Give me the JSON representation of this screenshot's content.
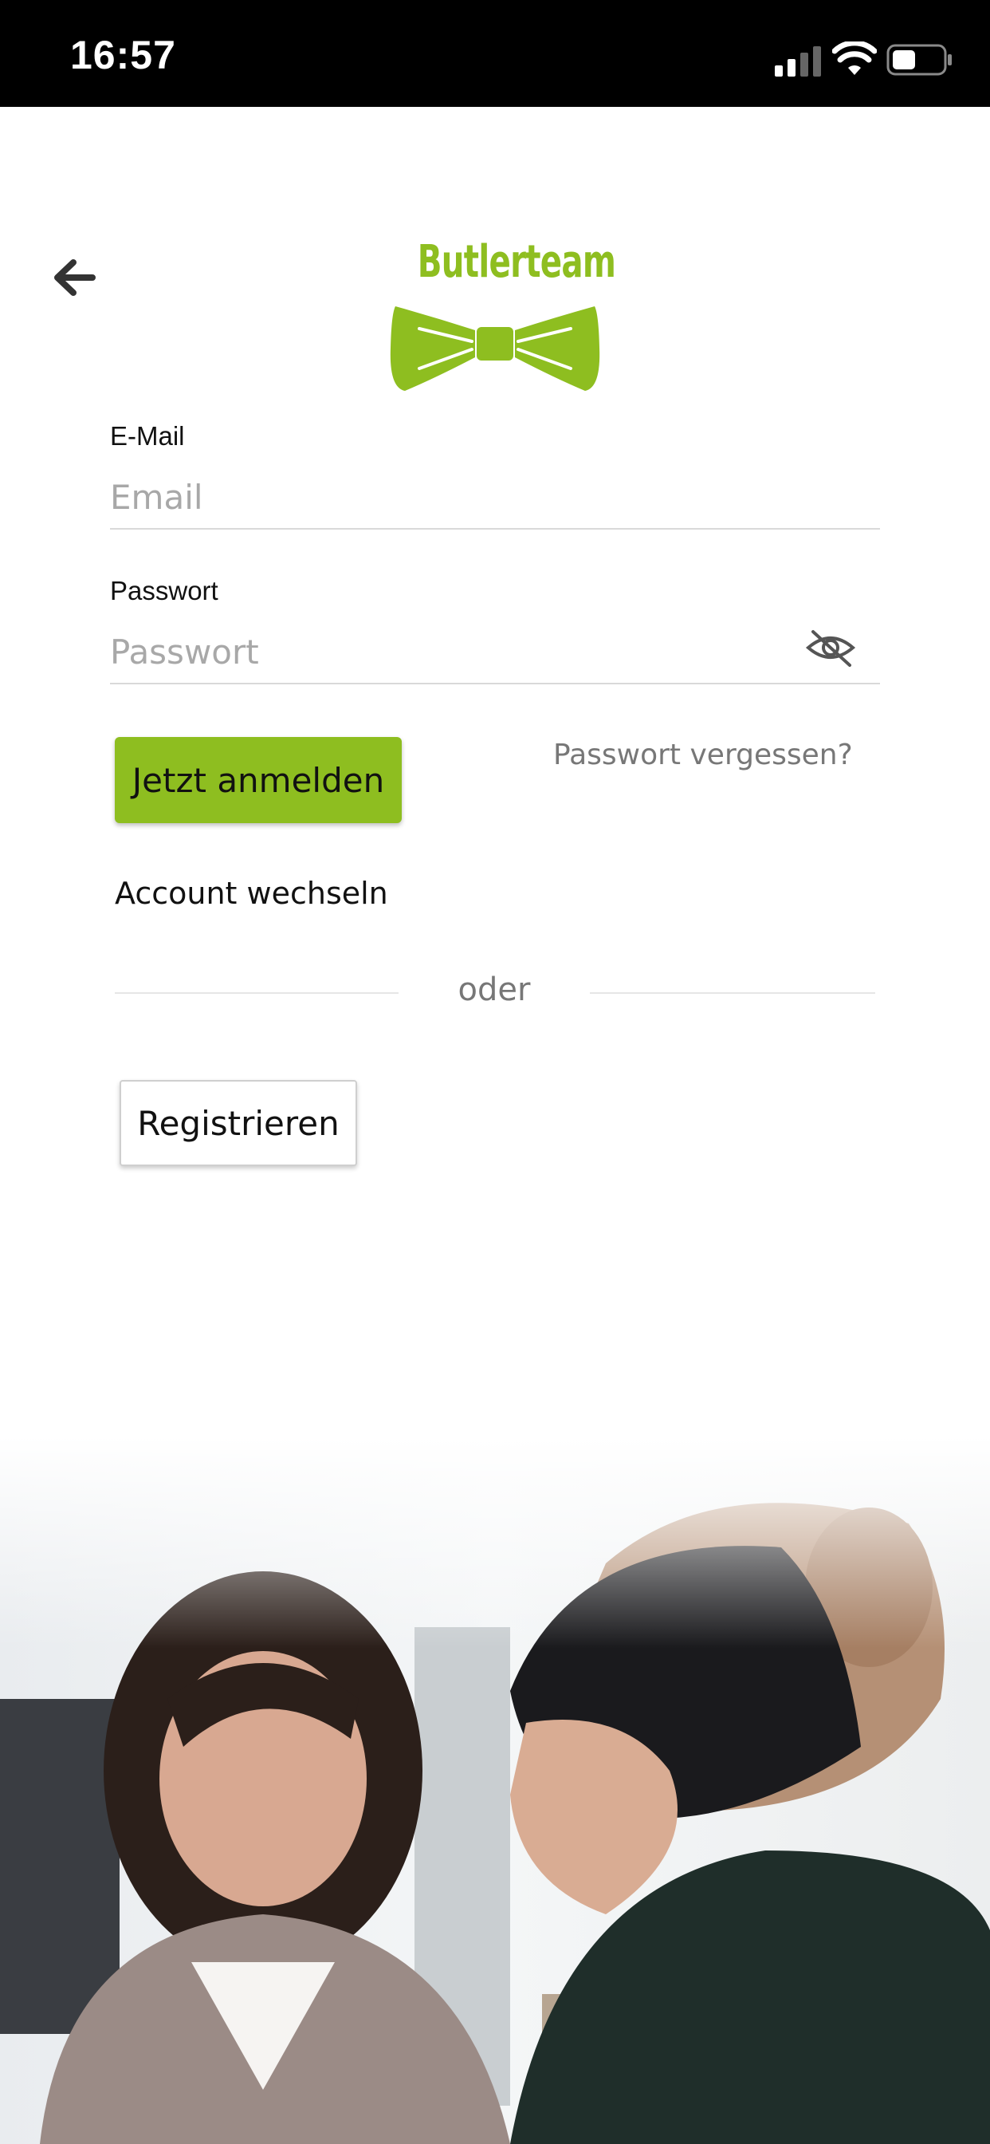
{
  "status_bar": {
    "time": "16:57"
  },
  "header": {
    "logo_text": "Butlerteam"
  },
  "form": {
    "email_label": "E-Mail",
    "email_placeholder": "Email",
    "email_value": "",
    "password_label": "Passwort",
    "password_placeholder": "Passwort",
    "password_value": ""
  },
  "actions": {
    "login_label": "Jetzt anmelden",
    "forgot_label": "Passwort vergessen?",
    "switch_account_label": "Account wechseln",
    "divider_label": "oder",
    "register_label": "Registrieren"
  },
  "theme": {
    "accent": "#8ebe20",
    "status_bar_bg": "#000000"
  },
  "icons": [
    "signal-icon",
    "wifi-icon",
    "battery-icon",
    "back-arrow-icon",
    "eye-off-icon"
  ]
}
